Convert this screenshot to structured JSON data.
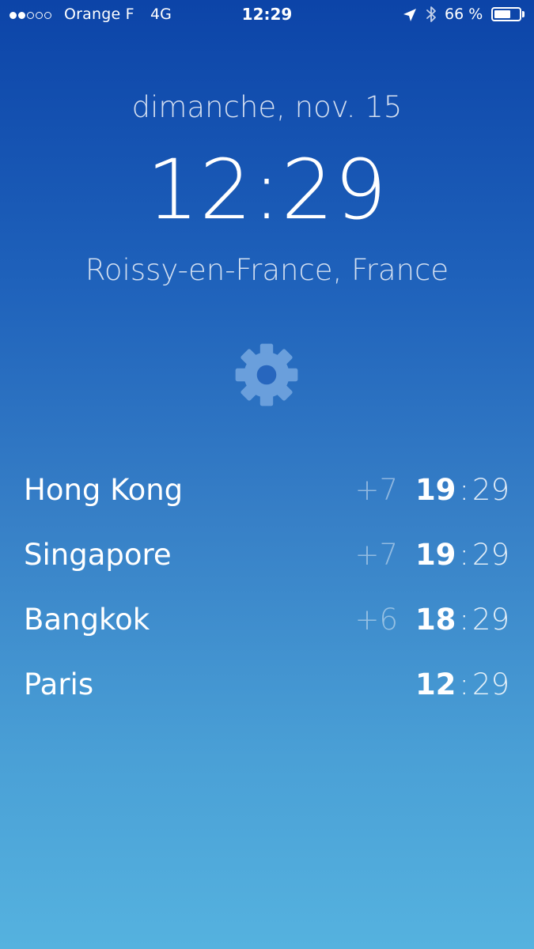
{
  "status_bar": {
    "signal_filled": 2,
    "signal_total": 5,
    "carrier": "Orange F",
    "network": "4G",
    "time": "12:29",
    "battery_percent_text": "66 %",
    "battery_level": 0.66,
    "icons": [
      "location-arrow-icon",
      "bluetooth-icon",
      "battery-icon"
    ]
  },
  "header": {
    "date": "dimanche, nov. 15",
    "time": "12:29",
    "location": "Roissy-en-France, France"
  },
  "settings": {
    "icon": "gear-icon"
  },
  "cities": [
    {
      "name": "Hong Kong",
      "offset": "+7",
      "hour": "19",
      "separator": ":",
      "minute": "29"
    },
    {
      "name": "Singapore",
      "offset": "+7",
      "hour": "19",
      "separator": ":",
      "minute": "29"
    },
    {
      "name": "Bangkok",
      "offset": "+6",
      "hour": "18",
      "separator": ":",
      "minute": "29"
    },
    {
      "name": "Paris",
      "offset": "",
      "hour": "12",
      "separator": ":",
      "minute": "29"
    }
  ],
  "colors": {
    "gradient_top": "#0c44a8",
    "gradient_bottom": "#55b2df",
    "gear": "#6a9fdc"
  }
}
